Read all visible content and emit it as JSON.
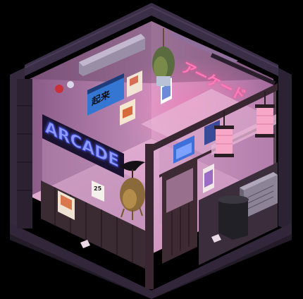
{
  "scene": {
    "sign_arcade": "ARCADE",
    "neon_katakana": "アーケード",
    "banner_kanji": "起来",
    "poster_number": "25"
  },
  "colors": {
    "background": "#000000",
    "neon_blue": "#5a6bff",
    "neon_pink": "#ff4f9a",
    "wall_purple": "#3a2940",
    "wood_dark": "#2c1c22",
    "lantern_pink": "#f7a8c8",
    "interior_glow": "#c98fb6"
  },
  "icons": [
    "bat-icon",
    "lantern-icon",
    "trash-bin-icon",
    "plant-icon",
    "crow-icon"
  ]
}
